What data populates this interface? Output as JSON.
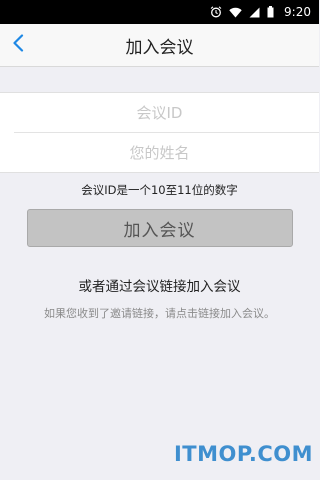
{
  "status_bar": {
    "time": "9:20",
    "icons": [
      "alarm-icon",
      "wifi-icon",
      "signal-icon",
      "battery-icon"
    ]
  },
  "header": {
    "title": "加入会议",
    "back_icon": "chevron-left-icon"
  },
  "form": {
    "meeting_id_placeholder": "会议ID",
    "meeting_id_value": "",
    "name_placeholder": "您的姓名",
    "name_value": ""
  },
  "hint": "会议ID是一个10至11位的数字",
  "join_button_label": "加入会议",
  "link_section": {
    "title": "或者通过会议链接加入会议",
    "description": "如果您收到了邀请链接，请点击链接加入会议。"
  },
  "watermark": "ITMOP.COM",
  "colors": {
    "accent": "#1e88e5",
    "page_background": "#efeff4",
    "button_background": "#c3c3c3",
    "watermark": "#3f8fcf"
  }
}
